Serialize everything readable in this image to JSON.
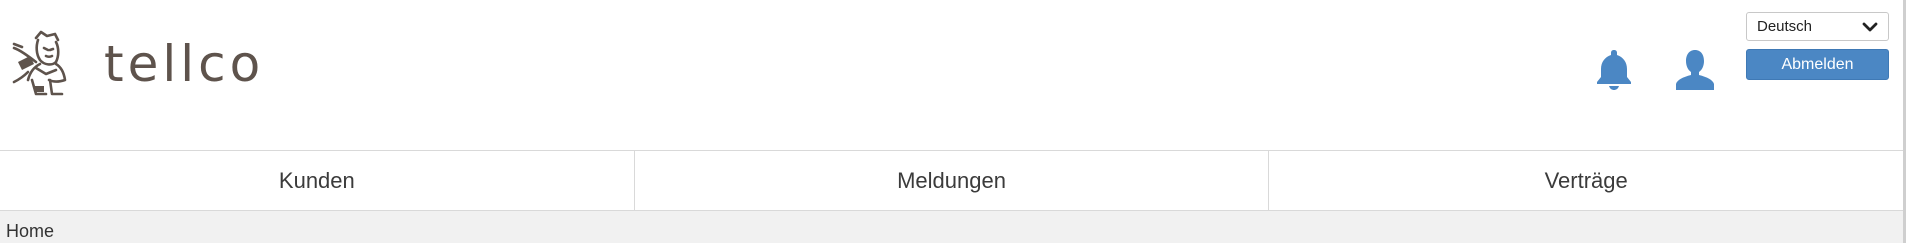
{
  "brand": {
    "logo_text": "tellco",
    "logo_icon": "mascot-logo-icon"
  },
  "header": {
    "notifications_icon": "bell-icon",
    "profile_icon": "user-icon",
    "language": {
      "selected": "Deutsch",
      "icon": "chevron-down-icon"
    },
    "logout_label": "Abmelden"
  },
  "nav": {
    "items": [
      {
        "label": "Kunden"
      },
      {
        "label": "Meldungen"
      },
      {
        "label": "Verträge"
      }
    ]
  },
  "breadcrumb": {
    "current": "Home"
  },
  "colors": {
    "accent": "#4b87c4",
    "logo": "#5e534c",
    "breadcrumb_bg": "#f1f1f1"
  }
}
